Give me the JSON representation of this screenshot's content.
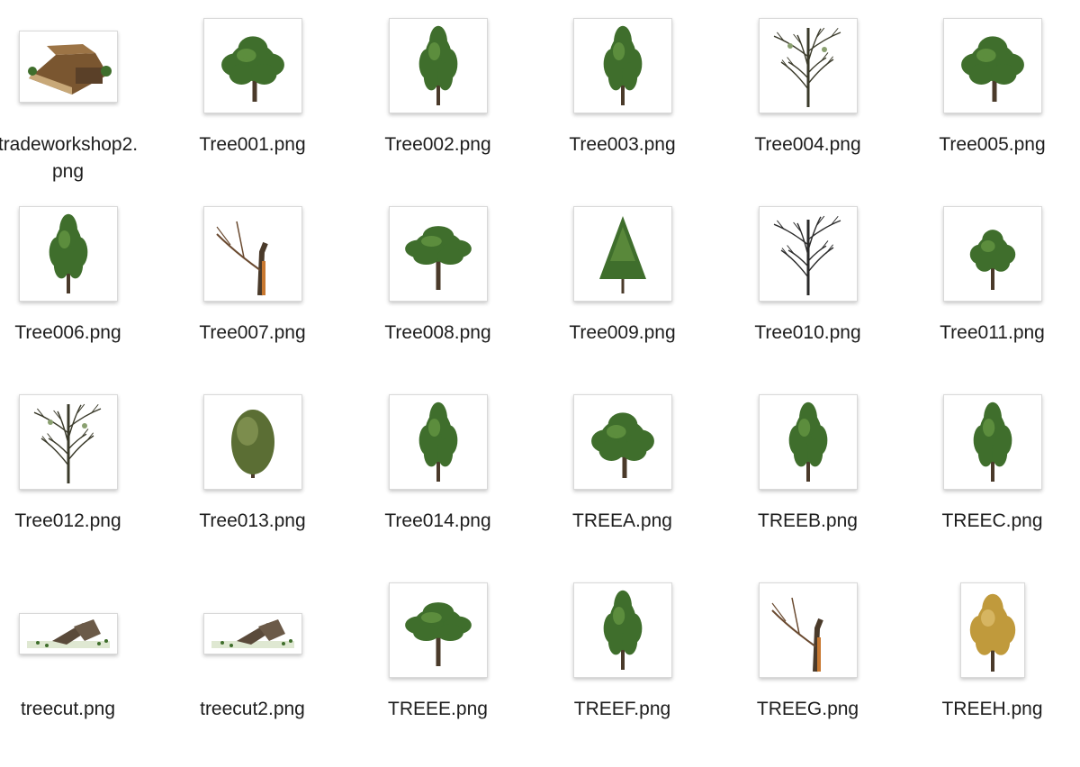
{
  "files": [
    {
      "name": "tradeworkshop2.\npng",
      "kind": "building"
    },
    {
      "name": "Tree001.png",
      "kind": "leafy"
    },
    {
      "name": "Tree002.png",
      "kind": "tall"
    },
    {
      "name": "Tree003.png",
      "kind": "tall"
    },
    {
      "name": "Tree004.png",
      "kind": "bare"
    },
    {
      "name": "Tree005.png",
      "kind": "leafy"
    },
    {
      "name": "Tree006.png",
      "kind": "tall"
    },
    {
      "name": "Tree007.png",
      "kind": "dead"
    },
    {
      "name": "Tree008.png",
      "kind": "broad"
    },
    {
      "name": "Tree009.png",
      "kind": "conifer"
    },
    {
      "name": "Tree010.png",
      "kind": "bare-dark"
    },
    {
      "name": "Tree011.png",
      "kind": "round"
    },
    {
      "name": "Tree012.png",
      "kind": "bare"
    },
    {
      "name": "Tree013.png",
      "kind": "bush"
    },
    {
      "name": "Tree014.png",
      "kind": "tall"
    },
    {
      "name": "TREEA.png",
      "kind": "leafy"
    },
    {
      "name": "TREEB.png",
      "kind": "tall"
    },
    {
      "name": "TREEC.png",
      "kind": "tall"
    },
    {
      "name": "treecut.png",
      "kind": "log"
    },
    {
      "name": "treecut2.png",
      "kind": "log"
    },
    {
      "name": "TREEE.png",
      "kind": "broad"
    },
    {
      "name": "TREEF.png",
      "kind": "tall"
    },
    {
      "name": "TREEG.png",
      "kind": "dead"
    },
    {
      "name": "TREEH.png",
      "kind": "autumn"
    }
  ],
  "colors": {
    "foliage": "#3f6e2c",
    "foliage_light": "#6a9a45",
    "trunk": "#4a3a2a",
    "autumn": "#c09a3c",
    "roof": "#7a5630"
  }
}
